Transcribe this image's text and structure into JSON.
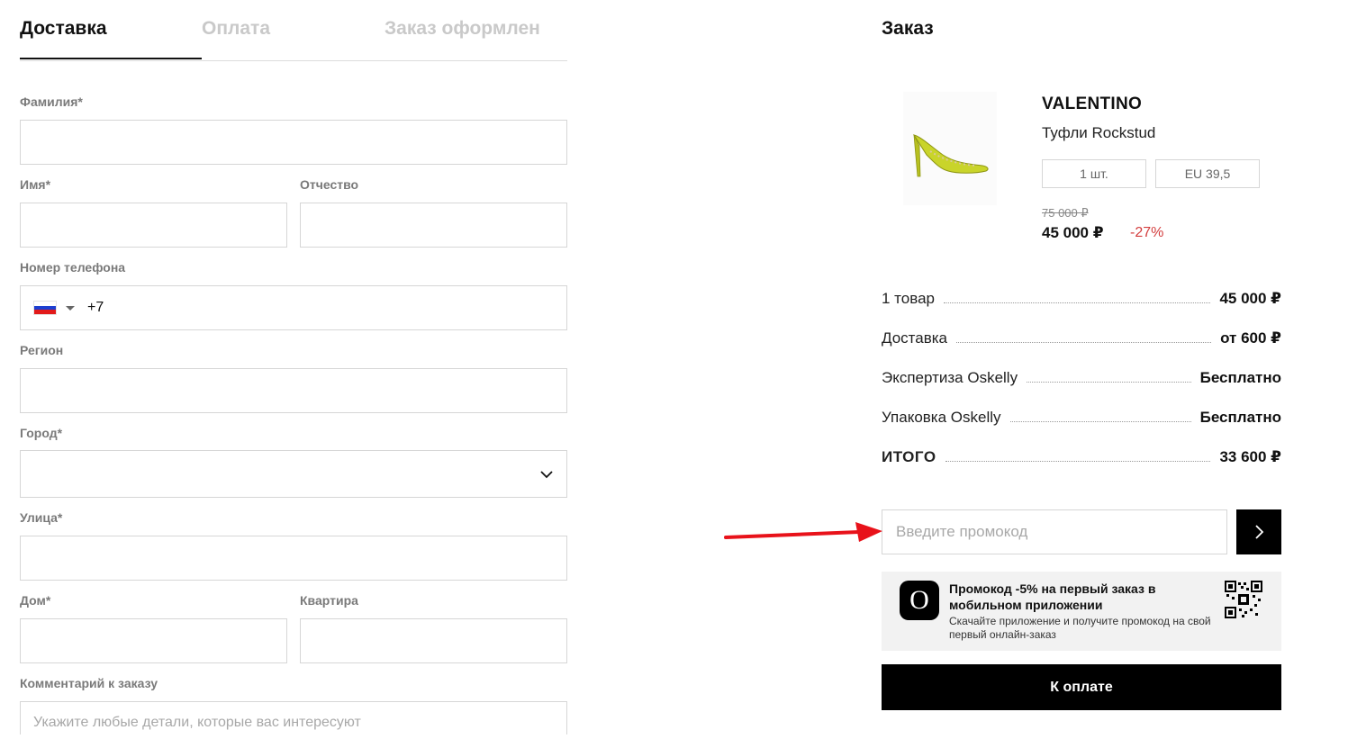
{
  "tabs": [
    {
      "label": "Доставка",
      "active": true
    },
    {
      "label": "Оплата",
      "active": false
    },
    {
      "label": "Заказ оформлен",
      "active": false
    }
  ],
  "form": {
    "last_name_label": "Фамилия*",
    "first_name_label": "Имя*",
    "middle_name_label": "Отчество",
    "phone_label": "Номер телефона",
    "phone_code": "+7",
    "region_label": "Регион",
    "city_label": "Город*",
    "street_label": "Улица*",
    "house_label": "Дом*",
    "apartment_label": "Квартира",
    "comment_label": "Комментарий к заказу",
    "comment_placeholder": "Укажите любые детали, которые вас интересуют"
  },
  "order": {
    "title": "Заказ",
    "product": {
      "brand": "VALENTINO",
      "name": "Туфли Rockstud",
      "quantity": "1 шт.",
      "size": "EU 39,5",
      "old_price": "75 000 ₽",
      "price": "45 000 ₽",
      "discount": "-27%"
    },
    "summary": [
      {
        "label": "1 товар",
        "value": "45 000 ₽"
      },
      {
        "label": "Доставка",
        "value": "от 600 ₽"
      },
      {
        "label": "Экспертиза Oskelly",
        "value": "Бесплатно"
      },
      {
        "label": "Упаковка Oskelly",
        "value": "Бесплатно"
      },
      {
        "label": "ИТОГО",
        "value": "33 600 ₽"
      }
    ],
    "promo_placeholder": "Введите промокод",
    "app_banner": {
      "title": "Промокод -5% на первый заказ в мобильном приложении",
      "text": "Скачайте приложение и получите промокод на свой первый онлайн-заказ",
      "logo_letter": "O"
    },
    "pay_label": "К оплате"
  },
  "colors": {
    "accent": "#000000",
    "discount": "#d33d3d",
    "arrow": "#e8121a"
  },
  "icons": [
    "russia-flag-icon",
    "caret-down-icon",
    "chevron-down-icon",
    "chevron-right-icon",
    "qr-code-icon",
    "app-logo-icon",
    "annotation-arrow"
  ]
}
